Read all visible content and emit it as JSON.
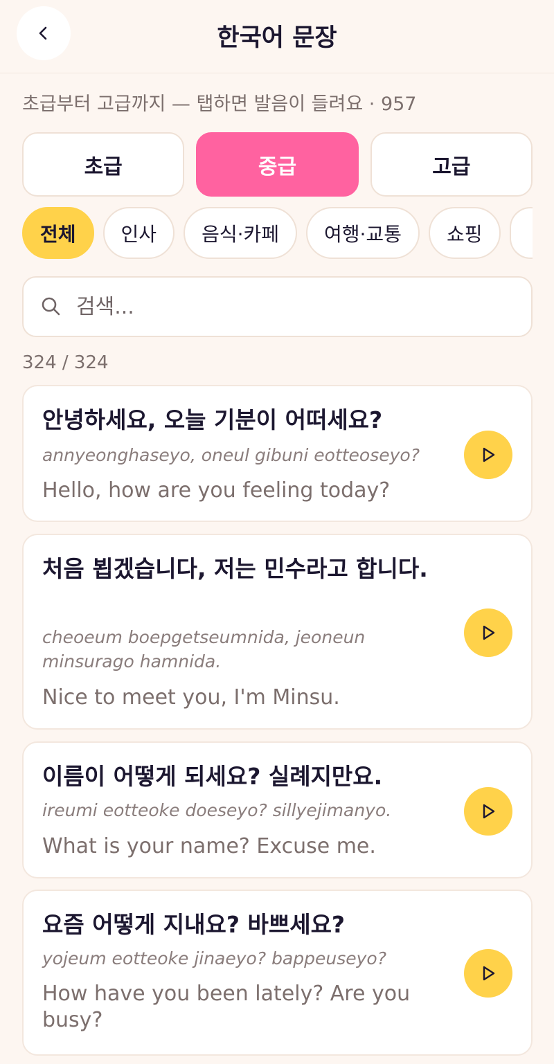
{
  "header": {
    "title": "한국어 문장",
    "back_icon": "chevron-left-icon"
  },
  "subtitle": "초급부터 고급까지 — 탭하면 발음이 들려요 · 957",
  "levels": [
    {
      "label": "초급",
      "active": false
    },
    {
      "label": "중급",
      "active": true
    },
    {
      "label": "고급",
      "active": false
    }
  ],
  "categories": [
    {
      "label": "전체",
      "active": true
    },
    {
      "label": "인사",
      "active": false
    },
    {
      "label": "음식·카페",
      "active": false
    },
    {
      "label": "여행·교통",
      "active": false
    },
    {
      "label": "쇼핑",
      "active": false
    },
    {
      "label": "",
      "active": false
    }
  ],
  "search": {
    "placeholder": "검색...",
    "value": "",
    "icon": "search-icon"
  },
  "result_count": "324 / 324",
  "phrases": [
    {
      "korean": "안녕하세요, 오늘 기분이 어떠세요?",
      "romanization": "annyeonghaseyo, oneul gibuni eotteoseyo?",
      "english": "Hello, how are you feeling today?"
    },
    {
      "korean": "처음 뵙겠습니다, 저는 민수라고 합니다.",
      "romanization": "cheoeum boepgetseumnida, jeoneun minsurago hamnida.",
      "english": "Nice to meet you, I'm Minsu."
    },
    {
      "korean": "이름이 어떻게 되세요? 실례지만요.",
      "romanization": "ireumi eotteoke doeseyo? sillyejimanyo.",
      "english": "What is your name? Excuse me."
    },
    {
      "korean": "요즘 어떻게 지내요? 바쁘세요?",
      "romanization": "yojeum eotteoke jinaeyo? bappeuseyo?",
      "english": "How have you been lately? Are you busy?"
    }
  ],
  "colors": {
    "background": "#fdf6f1",
    "accent_pink": "#ff62a0",
    "accent_yellow": "#ffd24a",
    "text_dark": "#1c1730",
    "text_muted": "#7c6f6d"
  },
  "play_icon": "play-icon"
}
